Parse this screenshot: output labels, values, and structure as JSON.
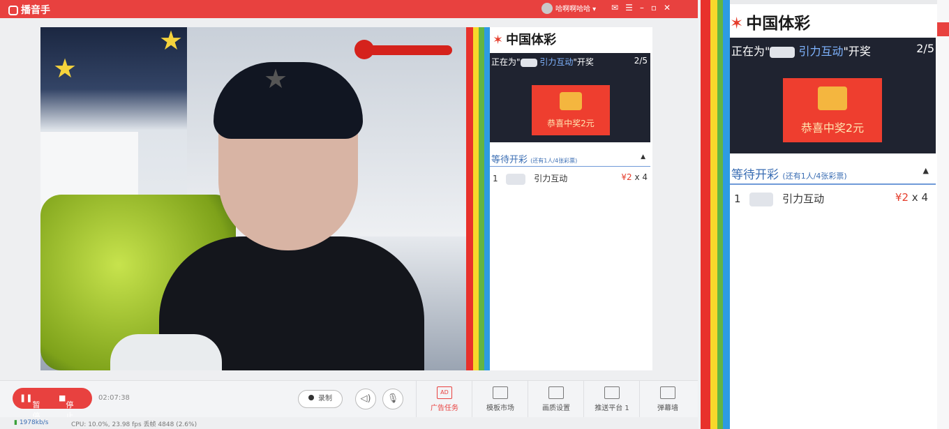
{
  "app": {
    "name": "播音手"
  },
  "user": {
    "name": "哈啊啊哈哈"
  },
  "overlay": {
    "brand": "中国体彩",
    "draw_prefix": "正在为\"",
    "draw_name": "引力互动",
    "draw_suffix": "\"开奖",
    "draw_progress": "2/5",
    "prize_text": "恭喜中奖2元",
    "waiting_title": "等待开彩",
    "waiting_sub": "(还有1人/4张彩票)",
    "collapse_icon": "▲",
    "queue": [
      {
        "rank": "1",
        "name": "引力互动",
        "price": "¥2",
        "qty": "x 4"
      }
    ]
  },
  "toolbar": {
    "pause_label": "暂停",
    "stop_label": "停止",
    "time": "02:07:38",
    "record_label": "录制",
    "tools": [
      {
        "label": "广告任务",
        "icon": "AD"
      },
      {
        "label": "模板市场",
        "icon": ""
      },
      {
        "label": "画质设置",
        "icon": ""
      },
      {
        "label": "推送平台 1",
        "icon": ""
      },
      {
        "label": "弹幕墙",
        "icon": ""
      }
    ]
  },
  "status": {
    "bandwidth": "1978kb/s",
    "perf": "CPU: 10.0%, 23.98 fps 丢帧 4848 (2.6%)"
  },
  "colors": {
    "accent": "#e8413f",
    "link": "#3a6db3"
  }
}
